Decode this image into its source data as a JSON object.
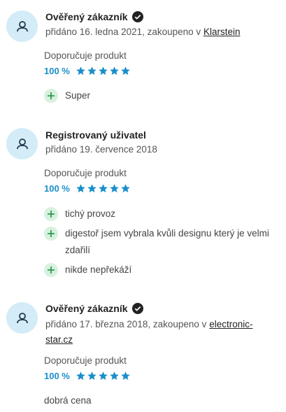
{
  "colors": {
    "accent": "#1a8fc9",
    "avatar_bg": "#d3ecf7",
    "plus_bg": "#d8f1df",
    "plus_fg": "#2e9b4e"
  },
  "reviews": [
    {
      "author": "Ověřený zákazník",
      "verified": true,
      "meta_prefix": "přidáno 16. ledna 2021, zakoupeno v ",
      "shop": "Klarstein",
      "recommend": "Doporučuje produkt",
      "percent": "100 %",
      "stars": 5,
      "pros": [
        "Super"
      ]
    },
    {
      "author": "Registrovaný uživatel",
      "verified": false,
      "meta_prefix": "přidáno 19. července 2018",
      "recommend": "Doporučuje produkt",
      "percent": "100 %",
      "stars": 5,
      "pros": [
        "tichý provoz",
        "digestoř jsem vybrala kvůli designu který je velmi zdařilí",
        "nikde nepřekáží"
      ]
    },
    {
      "author": "Ověřený zákazník",
      "verified": true,
      "meta_prefix": "přidáno 17. března 2018, zakoupeno v ",
      "shop": "electronic-star.cz",
      "recommend": "Doporučuje produkt",
      "percent": "100 %",
      "stars": 5,
      "comment": "dobrá cena"
    }
  ]
}
